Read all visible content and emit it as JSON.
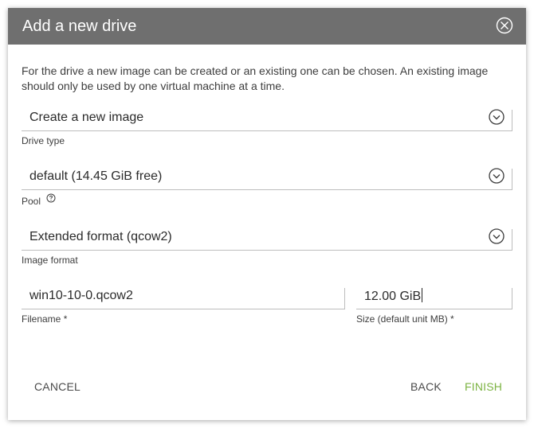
{
  "dialog": {
    "title": "Add a new drive",
    "close_icon": "close-circle-icon",
    "description": "For the drive a new image can be created or an existing one can be chosen. An existing image should only be used by one virtual machine at a time.",
    "drive_type": {
      "value": "Create a new image",
      "label": "Drive type"
    },
    "pool": {
      "value": "default (14.45 GiB free)",
      "label": "Pool",
      "help_icon": "question-circle-icon"
    },
    "image_format": {
      "value": "Extended format (qcow2)",
      "label": "Image format"
    },
    "filename": {
      "value": "win10-10-0.qcow2",
      "label": "Filename *"
    },
    "size": {
      "value": "12.00 GiB",
      "label": "Size (default unit MB) *"
    },
    "buttons": {
      "cancel": "CANCEL",
      "back": "BACK",
      "finish": "FINISH"
    },
    "colors": {
      "titlebar": "#6f6f6f",
      "accent": "#7cb342",
      "text": "#3d3d3d"
    }
  }
}
